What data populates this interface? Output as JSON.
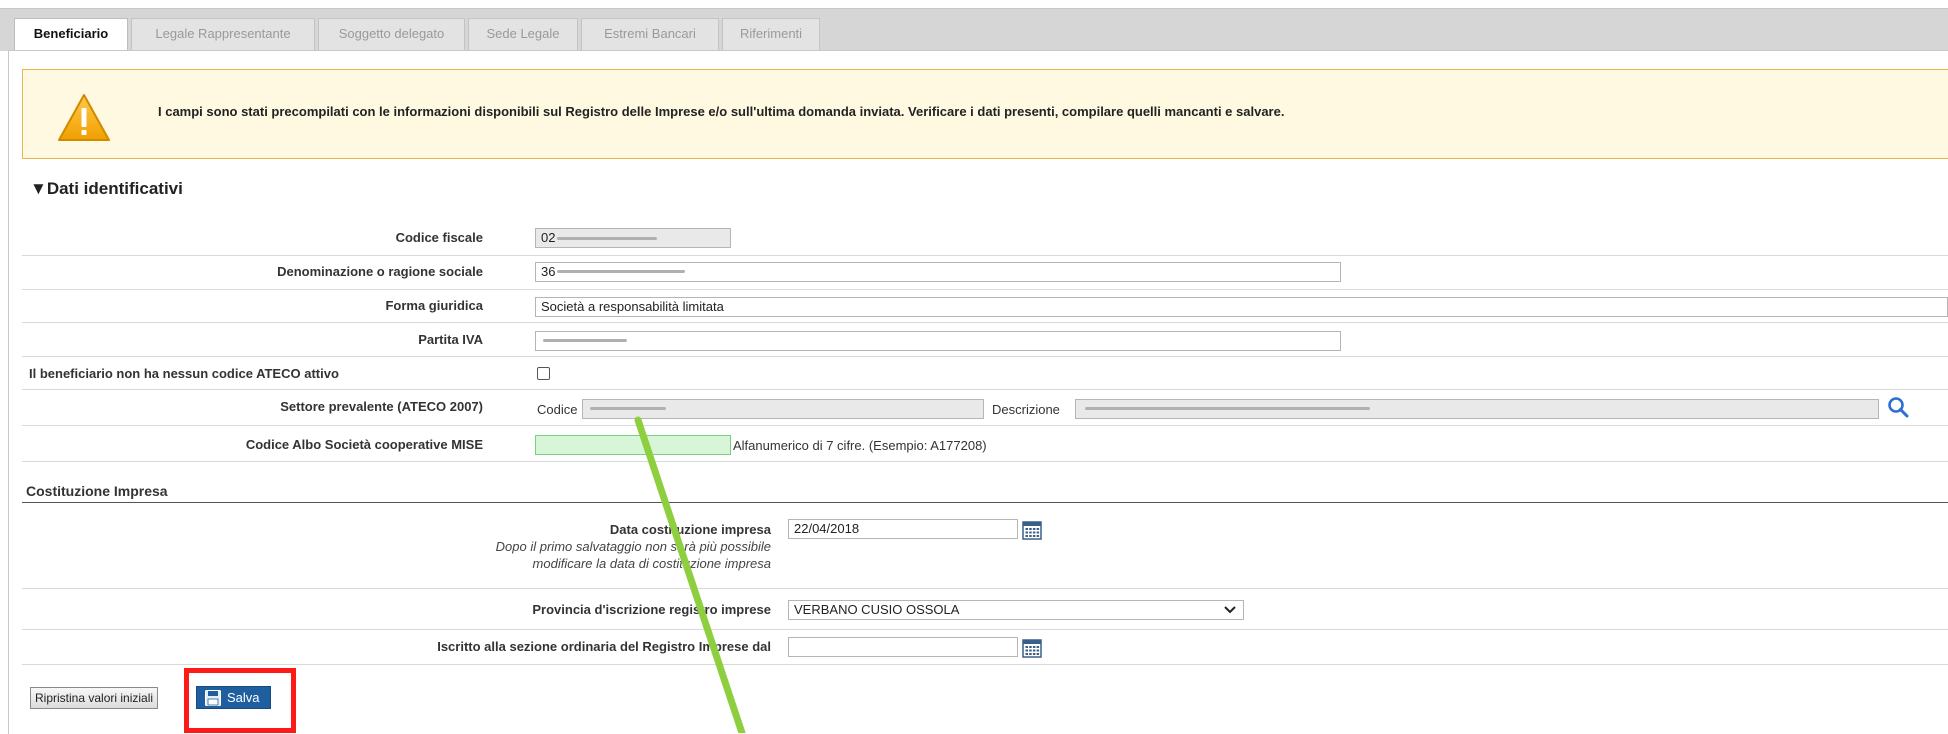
{
  "tabs": [
    {
      "label": "Beneficiario",
      "active": true
    },
    {
      "label": "Legale Rappresentante",
      "active": false
    },
    {
      "label": "Soggetto delegato",
      "active": false
    },
    {
      "label": "Sede Legale",
      "active": false
    },
    {
      "label": "Estremi Bancari",
      "active": false
    },
    {
      "label": "Riferimenti",
      "active": false
    }
  ],
  "warning": {
    "icon": "warning-icon",
    "text": "I campi sono stati precompilati con le informazioni disponibili sul Registro delle Imprese e/o sull'ultima domanda inviata. Verificare i dati presenti, compilare quelli mancanti e salvare."
  },
  "section": {
    "title": "▼Dati identificativi"
  },
  "fields": {
    "codice_fiscale": {
      "label": "Codice fiscale",
      "value": "02"
    },
    "denominazione": {
      "label": "Denominazione o ragione sociale",
      "value": "36"
    },
    "forma_giuridica": {
      "label": "Forma giuridica",
      "value": "Società a responsabilità limitata"
    },
    "partita_iva": {
      "label": "Partita IVA",
      "value": ""
    },
    "no_ateco": {
      "label": "Il beneficiario non ha nessun codice ATECO attivo",
      "checked": false
    },
    "settore": {
      "label": "Settore prevalente (ATECO 2007)",
      "codice_label": "Codice",
      "descrizione_label": "Descrizione",
      "search_icon": "search-icon"
    },
    "albo": {
      "label": "Codice Albo Società cooperative MISE",
      "value": "",
      "hint": "Alfanumerico di 7 cifre. (Esempio: A177208)"
    }
  },
  "costituzione": {
    "title": "Costituzione Impresa",
    "data": {
      "label": "Data costituzione impresa",
      "note1": "Dopo il primo salvataggio non sarà più possibile",
      "note2": "modificare la data di costituzione impresa",
      "value": "22/04/2018",
      "icon": "calendar-icon"
    },
    "provincia": {
      "label": "Provincia d'iscrizione registro imprese",
      "value": "VERBANO CUSIO OSSOLA"
    },
    "iscritto": {
      "label": "Iscritto alla sezione ordinaria del Registro Imprese dal",
      "value": "",
      "icon": "calendar-icon"
    }
  },
  "buttons": {
    "reset": "Ripristina valori iniziali",
    "save": "Salva",
    "save_icon": "floppy-disk-icon"
  },
  "colors": {
    "highlight": "#ff1a1a",
    "arrow": "#8dcf3f",
    "save_bg": "#1f5fa0",
    "warning_border": "#e8b84a",
    "mise_field": "#d7f5d7"
  }
}
